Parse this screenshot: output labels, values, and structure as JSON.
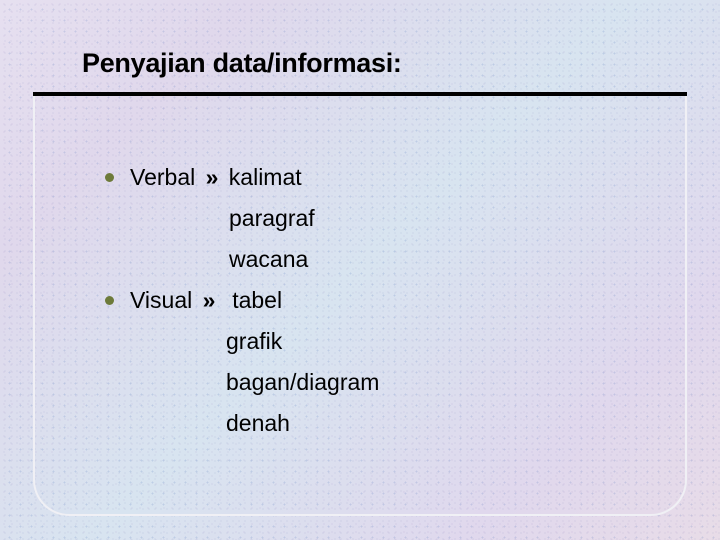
{
  "title": "Penyajian data/informasi:",
  "items": [
    {
      "label": "Verbal",
      "subs": [
        "kalimat",
        "paragraf",
        "wacana"
      ]
    },
    {
      "label": "Visual",
      "subs": [
        "tabel",
        "grafik",
        "bagan/diagram",
        "denah"
      ]
    }
  ],
  "arrow": "»"
}
